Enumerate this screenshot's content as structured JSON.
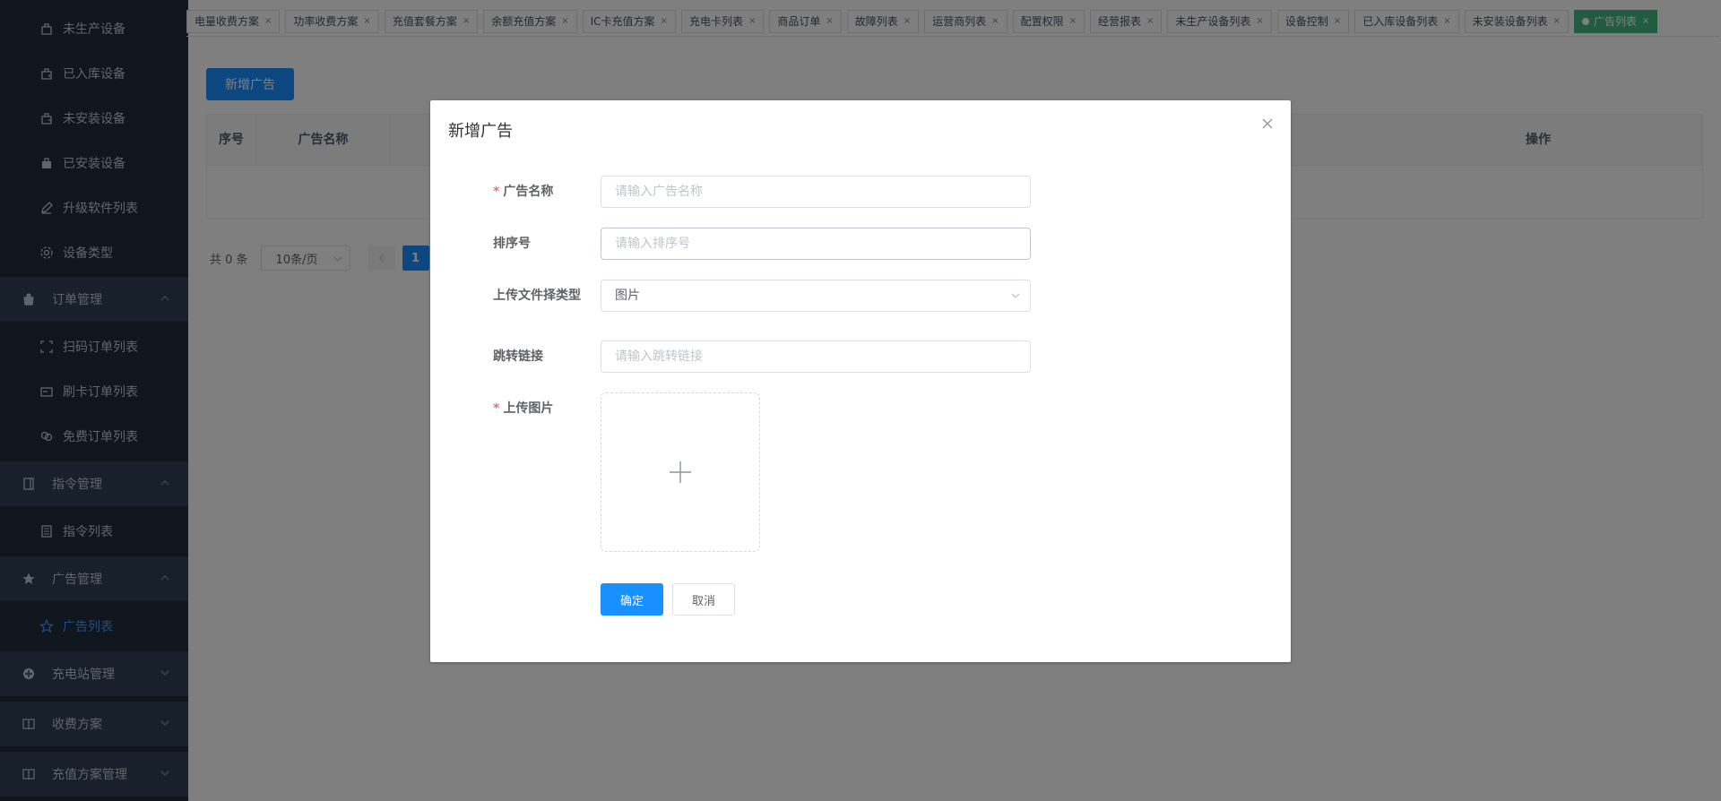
{
  "sidebar": {
    "items": [
      {
        "label": "未生产设备",
        "type": "sub",
        "icon": "box-icon"
      },
      {
        "label": "已入库设备",
        "type": "sub",
        "icon": "box-in-icon"
      },
      {
        "label": "未安装设备",
        "type": "sub",
        "icon": "box-pending-icon"
      },
      {
        "label": "已安装设备",
        "type": "sub",
        "icon": "box-filled-icon"
      },
      {
        "label": "升级软件列表",
        "type": "sub",
        "icon": "pen-icon"
      },
      {
        "label": "设备类型",
        "type": "sub",
        "icon": "gear-icon"
      },
      {
        "label": "订单管理",
        "type": "group",
        "icon": "bag-icon"
      },
      {
        "label": "扫码订单列表",
        "type": "sub",
        "icon": "scan-icon"
      },
      {
        "label": "刷卡订单列表",
        "type": "sub",
        "icon": "card-icon"
      },
      {
        "label": "免费订单列表",
        "type": "sub",
        "icon": "link-icon"
      },
      {
        "label": "指令管理",
        "type": "group",
        "icon": "book-icon"
      },
      {
        "label": "指令列表",
        "type": "sub",
        "icon": "list-icon"
      },
      {
        "label": "广告管理",
        "type": "group",
        "icon": "star-icon"
      },
      {
        "label": "广告列表",
        "type": "sub",
        "icon": "star-outline-icon",
        "active": true
      },
      {
        "label": "充电站管理",
        "type": "group",
        "icon": "station-icon"
      },
      {
        "label": "收费方案",
        "type": "group",
        "icon": "open-book-icon"
      },
      {
        "label": "充值方案管理",
        "type": "group",
        "icon": "open-book-icon"
      }
    ]
  },
  "tags": [
    {
      "label": "电量收费方案"
    },
    {
      "label": "功率收费方案"
    },
    {
      "label": "充值套餐方案"
    },
    {
      "label": "余额充值方案"
    },
    {
      "label": "IC卡充值方案"
    },
    {
      "label": "充电卡列表"
    },
    {
      "label": "商品订单"
    },
    {
      "label": "故障列表"
    },
    {
      "label": "运营商列表"
    },
    {
      "label": "配置权限"
    },
    {
      "label": "经营报表"
    },
    {
      "label": "未生产设备列表"
    },
    {
      "label": "设备控制"
    },
    {
      "label": "已入库设备列表"
    },
    {
      "label": "未安装设备列表"
    },
    {
      "label": "广告列表",
      "active": true
    }
  ],
  "page": {
    "add_button": "新增广告",
    "table_headers": [
      "序号",
      "广告名称",
      "操作"
    ],
    "pager": {
      "total": "共 0 条",
      "page_size": "10条/页",
      "current": "1"
    }
  },
  "dialog": {
    "title": "新增广告",
    "fields": {
      "name": {
        "label": "广告名称",
        "placeholder": "请输入广告名称",
        "required": true
      },
      "sort": {
        "label": "排序号",
        "placeholder": "请输入排序号"
      },
      "file_type": {
        "label": "上传文件择类型",
        "value": "图片"
      },
      "link": {
        "label": "跳转链接",
        "placeholder": "请输入跳转链接"
      },
      "image": {
        "label": "上传图片",
        "required": true
      }
    },
    "confirm": "确定",
    "cancel": "取消"
  },
  "colors": {
    "primary": "#1890ff",
    "sidebar": "#1f2d3d",
    "active_tag": "#42b983",
    "required": "#f56c6c"
  }
}
